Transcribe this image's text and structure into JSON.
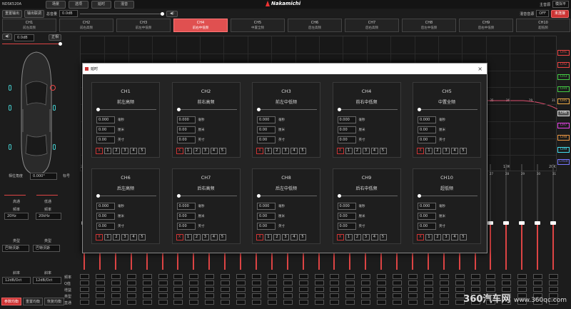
{
  "app": {
    "title": "NDSK520A",
    "brand": "Nakamichi"
  },
  "topbar": {
    "tabs": [
      "场景",
      "选项",
      "延时",
      "混音"
    ],
    "mode_label": "主音源",
    "mode_value": "模拟平",
    "mix_label": "混音音源",
    "mix_value": "OFF",
    "connect_label": "未连接"
  },
  "toolbar": {
    "btn1": "重置输出",
    "btn2": "输出联调",
    "total_label": "总音量",
    "total_value": "0.0dB"
  },
  "channels": [
    {
      "ch": "CH1",
      "sub": "前左高频"
    },
    {
      "ch": "CH2",
      "sub": "前右高频"
    },
    {
      "ch": "CH3",
      "sub": "前左中低频"
    },
    {
      "ch": "CH4",
      "sub": "前右中低频"
    },
    {
      "ch": "CH5",
      "sub": "中置全频"
    },
    {
      "ch": "CH6",
      "sub": "后左高频"
    },
    {
      "ch": "CH7",
      "sub": "后右高频"
    },
    {
      "ch": "CH8",
      "sub": "后左中低频"
    },
    {
      "ch": "CH9",
      "sub": "后右中低频"
    },
    {
      "ch": "CH10",
      "sub": "超低频"
    }
  ],
  "left": {
    "vol": "0.0dB",
    "front_label": "正相",
    "angle_label": "相位角度",
    "angle_value": "0.000°",
    "phase_btn": "标号",
    "hp_label": "高通",
    "lp_label": "低通",
    "freq_label": "频率",
    "hp_freq": "20Hz",
    "lp_freq": "20kHz",
    "type_label": "类型",
    "hp_type": "巴特沃斯",
    "lp_type": "巴特沃斯",
    "slope_label": "斜率",
    "hp_slope": "12dB/Oct",
    "lp_slope": "12dB/Oct",
    "eq_labels": [
      "频率",
      "Q值",
      "增益",
      "类型",
      "直通"
    ],
    "btn_reset": "重置均衡",
    "btn_restore": "恢复均衡",
    "btn_param": "参数均衡"
  },
  "graph": {
    "freq_labels": [
      "20",
      "10K",
      "20K"
    ],
    "points": [
      "-25",
      "26",
      "29",
      "31"
    ]
  },
  "legend": [
    "CH1",
    "CH2",
    "CH3",
    "CH4",
    "CH5",
    "CH6",
    "CH7",
    "CH8",
    "CH9",
    "CH10"
  ],
  "legend_colors": [
    "#e44",
    "#e44",
    "#4c4",
    "#4c4",
    "#ea4",
    "#ddd",
    "#e4e",
    "#e94",
    "#4de",
    "#77f"
  ],
  "fader_top": [
    "27",
    "28",
    "29",
    "30",
    "31"
  ],
  "dialog": {
    "title": "延时",
    "close": "×",
    "unit_ms": "毫秒",
    "unit_cm": "厘米",
    "unit_in": "英寸",
    "x_btn": "X",
    "nums": [
      "1",
      "2",
      "3",
      "4",
      "5"
    ],
    "cards": [
      {
        "ch": "CH1",
        "name": "前左高频",
        "ms": "0.000",
        "cm": "0.00",
        "in": "0.00"
      },
      {
        "ch": "CH2",
        "name": "前右高频",
        "ms": "0.000",
        "cm": "0.00",
        "in": "0.00"
      },
      {
        "ch": "CH3",
        "name": "前左中低频",
        "ms": "0.000",
        "cm": "0.00",
        "in": "0.00"
      },
      {
        "ch": "CH4",
        "name": "前右中低频",
        "ms": "0.000",
        "cm": "0.00",
        "in": "0.00"
      },
      {
        "ch": "CH5",
        "name": "中置全频",
        "ms": "0.000",
        "cm": "0.00",
        "in": "0.00"
      },
      {
        "ch": "CH6",
        "name": "后左高频",
        "ms": "0.000",
        "cm": "0.00",
        "in": "0.00"
      },
      {
        "ch": "CH7",
        "name": "后右高频",
        "ms": "0.000",
        "cm": "0.00",
        "in": "0.00"
      },
      {
        "ch": "CH8",
        "name": "后左中低频",
        "ms": "0.000",
        "cm": "0.00",
        "in": "0.00"
      },
      {
        "ch": "CH9",
        "name": "后右中低频",
        "ms": "0.000",
        "cm": "0.00",
        "in": "0.00"
      },
      {
        "ch": "CH10",
        "name": "超低频",
        "ms": "0.000",
        "cm": "0.00",
        "in": "0.00"
      }
    ]
  },
  "watermark": {
    "text": "360汽车网",
    "url": "www.360qc.com"
  }
}
